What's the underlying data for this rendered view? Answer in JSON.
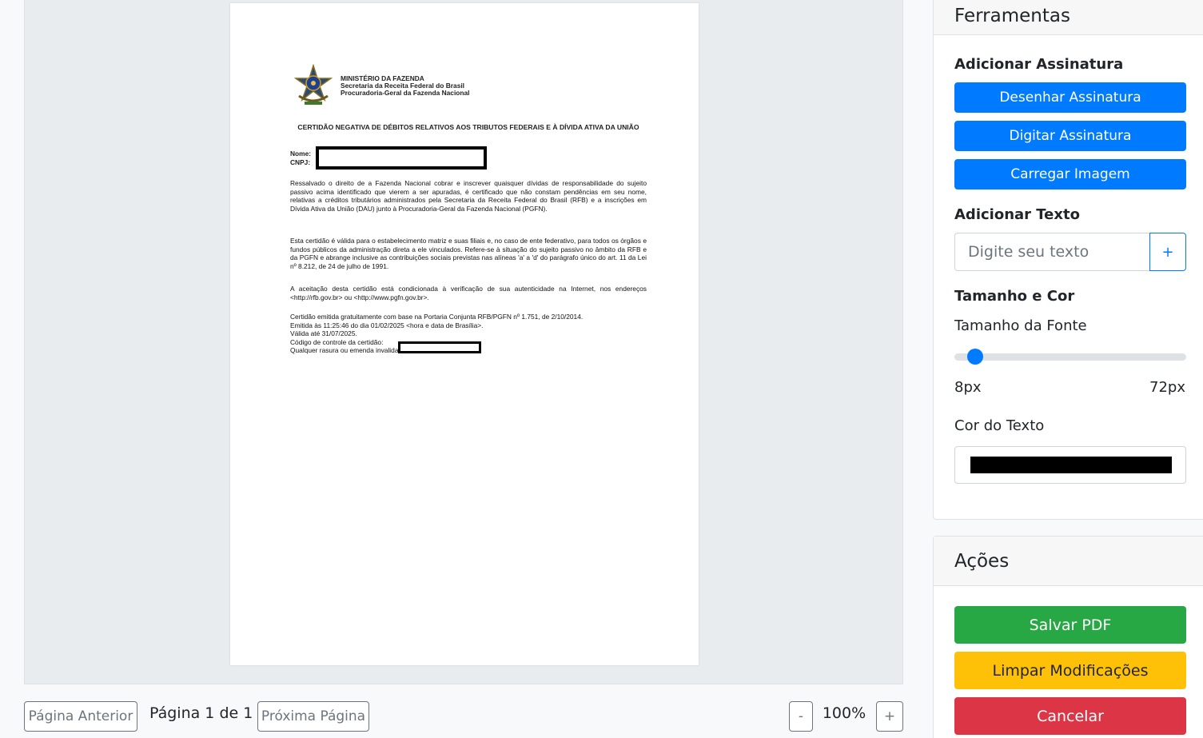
{
  "document": {
    "org_lines": [
      "MINISTÉRIO DA FAZENDA",
      "Secretaria da Receita Federal do Brasil",
      "Procuradoria-Geral da Fazenda Nacional"
    ],
    "title": "CERTIDÃO NEGATIVA DE DÉBITOS RELATIVOS AOS TRIBUTOS FEDERAIS E À DÍVIDA ATIVA DA UNIÃO",
    "field_name": "Nome:",
    "field_cnpj": "CNPJ:",
    "paragraph1": "Ressalvado o direito de a Fazenda Nacional cobrar e inscrever quaisquer dívidas de responsabilidade do sujeito passivo acima identificado que vierem a ser apuradas, é certificado que não constam pendências em seu nome, relativas a créditos tributários administrados pela Secretaria da Receita Federal do Brasil (RFB) e a inscrições em Dívida Ativa da União (DAU) junto à Procuradoria-Geral da Fazenda Nacional (PGFN).",
    "paragraph2": "Esta certidão é válida para o estabelecimento matriz e suas filiais e, no caso de ente federativo, para todos os órgãos e fundos públicos da administração direta a ele vinculados. Refere-se à situação do sujeito passivo no âmbito da RFB e da PGFN e abrange inclusive as contribuições sociais previstas nas alíneas 'a' a 'd' do parágrafo único do art. 11 da Lei nº 8.212, de 24 de julho de 1991.",
    "paragraph3": "A aceitação desta certidão está condicionada à verificação de sua autenticidade na Internet, nos endereços <http://rfb.gov.br> ou <http://www.pgfn.gov.br>.",
    "footer_lines": [
      "Certidão emitida gratuitamente com base na Portaria Conjunta RFB/PGFN nº 1.751, de 2/10/2014.",
      "Emitida às 11:25:46 do dia 01/02/2025 <hora e data de Brasília>.",
      "Válida até 31/07/2025.",
      "Código de controle da certidão:",
      "Qualquer rasura ou emenda invalidará este documento."
    ]
  },
  "pager": {
    "prev_label": "Página Anterior",
    "page_info": "Página 1 de 1",
    "next_label": "Próxima Página",
    "zoom_out": "-",
    "zoom_level": "100%",
    "zoom_in": "+"
  },
  "tools": {
    "header": "Ferramentas",
    "signature_title": "Adicionar Assinatura",
    "draw_signature": "Desenhar Assinatura",
    "type_signature": "Digitar Assinatura",
    "upload_image": "Carregar Imagem",
    "text_title": "Adicionar Texto",
    "text_placeholder": "Digite seu texto",
    "add_text_button": "+",
    "size_color_title": "Tamanho e Cor",
    "font_size_label": "Tamanho da Fonte",
    "font_size_value_fraction": 0.06,
    "font_min": "8px",
    "font_max": "72px",
    "text_color_label": "Cor do Texto",
    "text_color": "#000000"
  },
  "actions": {
    "header": "Ações",
    "save": "Salvar PDF",
    "clear": "Limpar Modificações",
    "cancel": "Cancelar"
  },
  "colors": {
    "primary": "#007bff",
    "success": "#28a745",
    "warning": "#ffc107",
    "danger": "#dc3545"
  }
}
